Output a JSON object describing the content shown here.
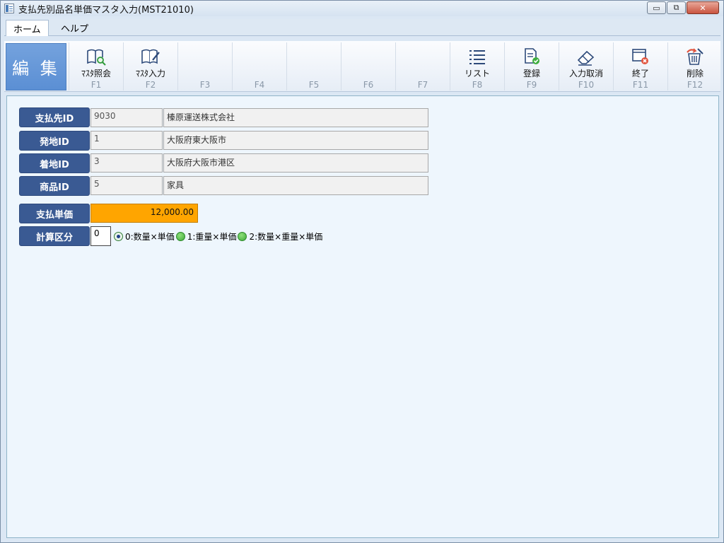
{
  "window": {
    "title": "支払先別品名単価マスタ入力(MST21010)",
    "buttons": {
      "minimize": "▭",
      "restore": "⧉",
      "close": "✕"
    }
  },
  "menu": {
    "tabs": [
      {
        "label": "ホーム",
        "active": true
      },
      {
        "label": "ヘルプ",
        "active": false
      }
    ]
  },
  "toolbar": {
    "mode_label": "編 集",
    "fkeys": [
      {
        "key": "F1",
        "label": "ﾏｽﾀ照会",
        "icon": "book-search-icon"
      },
      {
        "key": "F2",
        "label": "ﾏｽﾀ入力",
        "icon": "book-edit-icon"
      },
      {
        "key": "F3",
        "label": "",
        "icon": ""
      },
      {
        "key": "F4",
        "label": "",
        "icon": ""
      },
      {
        "key": "F5",
        "label": "",
        "icon": ""
      },
      {
        "key": "F6",
        "label": "",
        "icon": ""
      },
      {
        "key": "F7",
        "label": "",
        "icon": ""
      },
      {
        "key": "F8",
        "label": "リスト",
        "icon": "list-icon"
      },
      {
        "key": "F9",
        "label": "登録",
        "icon": "register-icon"
      },
      {
        "key": "F10",
        "label": "入力取消",
        "icon": "eraser-icon"
      },
      {
        "key": "F11",
        "label": "終了",
        "icon": "exit-icon"
      },
      {
        "key": "F12",
        "label": "削除",
        "icon": "trash-icon"
      }
    ]
  },
  "form": {
    "payee": {
      "label": "支払先ID",
      "id": "9030",
      "name": "榛原運送株式会社"
    },
    "origin": {
      "label": "発地ID",
      "id": "1",
      "name": "大阪府東大阪市"
    },
    "destination": {
      "label": "着地ID",
      "id": "3",
      "name": "大阪府大阪市港区"
    },
    "product": {
      "label": "商品ID",
      "id": "5",
      "name": "家具"
    },
    "unit_price": {
      "label": "支払単価",
      "value": "12,000.00"
    },
    "calc_type": {
      "label": "計算区分",
      "value": "0",
      "options": [
        {
          "label": "0:数量×単価",
          "selected": true
        },
        {
          "label": "1:重量×単価",
          "selected": false
        },
        {
          "label": "2:数量×重量×単価",
          "selected": false
        }
      ]
    }
  },
  "colors": {
    "label_bg": "#3a5a93",
    "price_bg": "#ffa500",
    "edit_bg": "#5b8fd4",
    "content_bg": "#eef6fd"
  }
}
